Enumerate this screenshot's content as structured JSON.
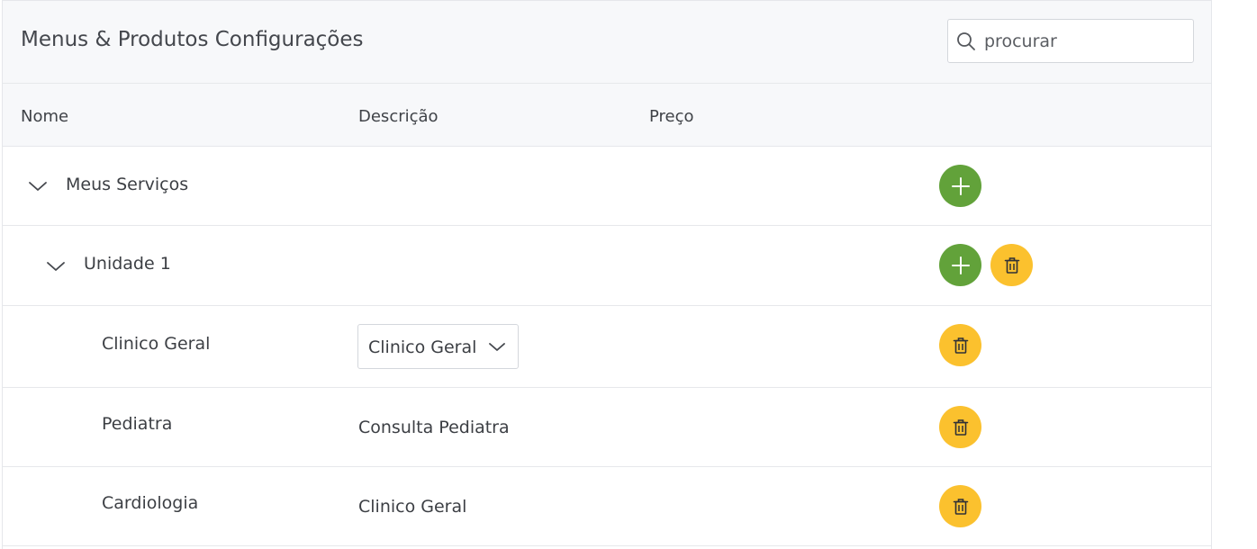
{
  "header": {
    "title": "Menus & Produtos Configurações",
    "search_placeholder": "procurar",
    "search_value": ""
  },
  "table": {
    "columns": [
      "Nome",
      "Descrição",
      "Preço"
    ],
    "rows": [
      {
        "name": "Meus Serviços",
        "level": 0,
        "expandable": true,
        "expanded": true,
        "description": "",
        "price": "",
        "actions": [
          "add-icon"
        ]
      },
      {
        "name": "Unidade 1",
        "level": 1,
        "expandable": true,
        "expanded": true,
        "description": "",
        "price": "",
        "actions": [
          "add-icon",
          "trash-icon"
        ]
      },
      {
        "name": "Clinico Geral",
        "level": 2,
        "expandable": false,
        "description_select": "Clinico Geral",
        "price": "",
        "actions": [
          "trash-icon"
        ]
      },
      {
        "name": "Pediatra",
        "level": 2,
        "expandable": false,
        "description": "Consulta Pediatra",
        "price": "",
        "actions": [
          "trash-icon"
        ]
      },
      {
        "name": "Cardiologia",
        "level": 2,
        "expandable": false,
        "description": "Clinico Geral",
        "price": "",
        "actions": [
          "trash-icon"
        ]
      }
    ]
  },
  "icons": {
    "search": "search-icon",
    "expand": "chevron-down-icon",
    "add": "add-icon",
    "delete": "trash-icon"
  },
  "colors": {
    "add_button": "#62a23a",
    "delete_button": "#fbc12e",
    "header_bg": "#f7f8fa",
    "border": "#e6e8eb"
  }
}
